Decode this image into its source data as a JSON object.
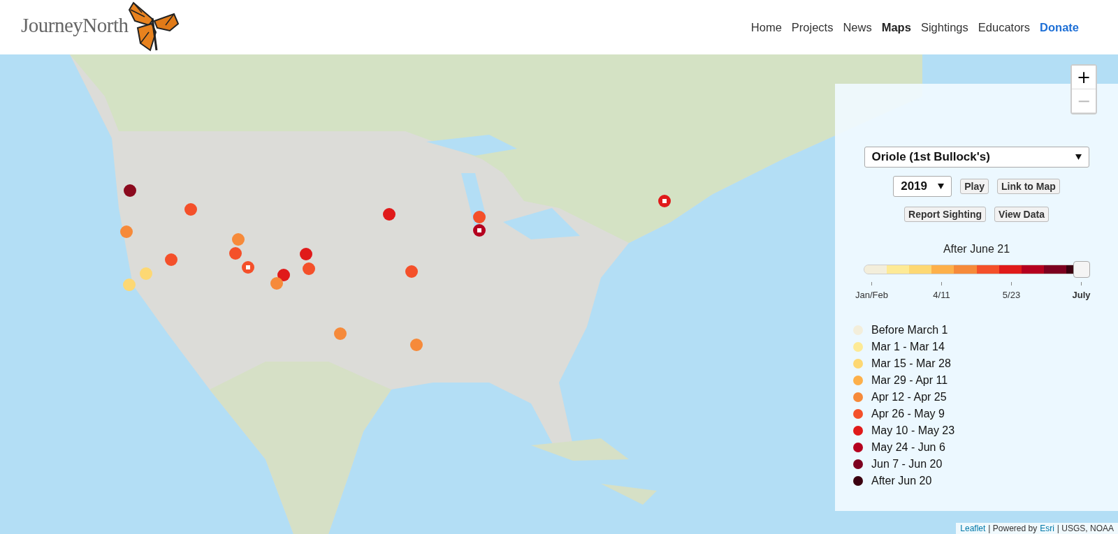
{
  "header": {
    "logo": "JourneyNorth",
    "nav": [
      {
        "label": "Home",
        "selected": false,
        "kind": "link"
      },
      {
        "label": "Projects",
        "selected": false,
        "kind": "link"
      },
      {
        "label": "News",
        "selected": false,
        "kind": "link"
      },
      {
        "label": "Maps",
        "selected": true,
        "kind": "link"
      },
      {
        "label": "Sightings",
        "selected": false,
        "kind": "link"
      },
      {
        "label": "Educators",
        "selected": false,
        "kind": "link"
      },
      {
        "label": "Donate",
        "selected": false,
        "kind": "donate"
      }
    ]
  },
  "map": {
    "kind": "picture",
    "markers": [
      {
        "kind": "dot",
        "color": "#8b0a1e"
      },
      {
        "kind": "dot",
        "color": "#f4502a"
      },
      {
        "kind": "dot",
        "color": "#f68a3a"
      },
      {
        "kind": "dot",
        "color": "#f68a3a"
      },
      {
        "kind": "dot",
        "color": "#f4502a"
      },
      {
        "kind": "dot",
        "color": "#f4502a"
      },
      {
        "kind": "square",
        "color": "#f4502a"
      },
      {
        "kind": "dot",
        "color": "#fdd873"
      },
      {
        "kind": "dot",
        "color": "#fdd873"
      },
      {
        "kind": "dot",
        "color": "#e01a1a"
      },
      {
        "kind": "dot",
        "color": "#f68a3a"
      },
      {
        "kind": "dot",
        "color": "#e01a1a"
      },
      {
        "kind": "dot",
        "color": "#f4502a"
      },
      {
        "kind": "dot",
        "color": "#e01a1a"
      },
      {
        "kind": "dot",
        "color": "#f4502a"
      },
      {
        "kind": "dot",
        "color": "#f4502a"
      },
      {
        "kind": "square",
        "color": "#b5001f"
      },
      {
        "kind": "square",
        "color": "#e01a1a"
      },
      {
        "kind": "dot",
        "color": "#f68a3a"
      },
      {
        "kind": "dot",
        "color": "#f68a3a"
      }
    ],
    "zoom": [
      {
        "label": "+",
        "disabled": false
      },
      {
        "label": "−",
        "disabled": true
      }
    ],
    "attribution": [
      {
        "text": "Leaflet",
        "kind": "link"
      },
      {
        "text": "| Powered by",
        "kind": "text"
      },
      {
        "text": "Esri",
        "kind": "link"
      },
      {
        "text": "| USGS, NOAA",
        "kind": "text"
      }
    ]
  },
  "panel": {
    "species": "Oriole (1st Bullock's)",
    "year": "2019",
    "buttons": [
      "Play",
      "Link to Map",
      "Report Sighting",
      "View Data"
    ],
    "period": "After June 21",
    "slider": {
      "level": 1.0
    },
    "ticks": [
      {
        "label": "Jan/Feb",
        "selected": false
      },
      {
        "label": "4/11",
        "selected": false
      },
      {
        "label": "5/23",
        "selected": false
      },
      {
        "label": "July",
        "selected": true
      }
    ],
    "legend": [
      {
        "label": "Before March 1",
        "color": "#f3eedb"
      },
      {
        "label": "Mar 1 - Mar 14",
        "color": "#fdea96"
      },
      {
        "label": "Mar 15 - Mar 28",
        "color": "#fdd873"
      },
      {
        "label": "Mar 29 - Apr 11",
        "color": "#fdb04a"
      },
      {
        "label": "Apr 12 - Apr 25",
        "color": "#f68a3a"
      },
      {
        "label": "Apr 26 - May 9",
        "color": "#f4502a"
      },
      {
        "label": "May 10 - May 23",
        "color": "#e01a1a"
      },
      {
        "label": "May 24 - Jun 6",
        "color": "#b5001f"
      },
      {
        "label": "Jun 7 - Jun 20",
        "color": "#7d0020"
      },
      {
        "label": "After Jun 20",
        "color": "#3b0010"
      }
    ]
  }
}
